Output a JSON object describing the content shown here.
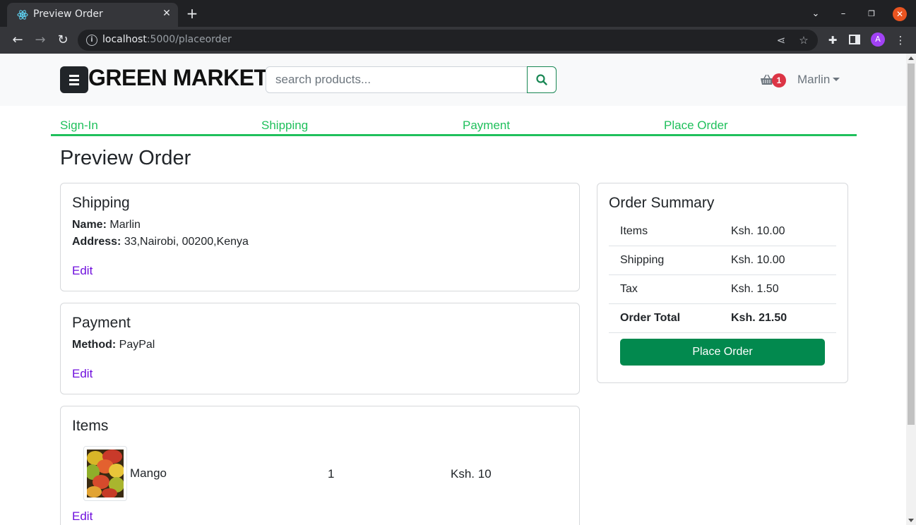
{
  "browser": {
    "tab_title": "Preview Order",
    "url_host": "localhost",
    "url_rest": ":5000/placeorder",
    "profile_initial": "A"
  },
  "navbar": {
    "brand": "GREEN MARKET",
    "search_placeholder": "search products...",
    "cart_count": "1",
    "user_name": "Marlin"
  },
  "checkout_steps": [
    "Sign-In",
    "Shipping",
    "Payment",
    "Place Order"
  ],
  "page_title": "Preview Order",
  "shipping_card": {
    "title": "Shipping",
    "name_label": "Name:",
    "name_value": "Marlin",
    "address_label": "Address:",
    "address_value": "33,Nairobi, 00200,Kenya",
    "edit_label": "Edit"
  },
  "payment_card": {
    "title": "Payment",
    "method_label": "Method:",
    "method_value": "PayPal",
    "edit_label": "Edit"
  },
  "items_card": {
    "title": "Items",
    "items": [
      {
        "name": "Mango",
        "quantity": "1",
        "price": "Ksh. 10"
      }
    ],
    "edit_label": "Edit"
  },
  "order_summary": {
    "title": "Order Summary",
    "rows": [
      {
        "label": "Items",
        "value": "Ksh. 10.00"
      },
      {
        "label": "Shipping",
        "value": "Ksh. 10.00"
      },
      {
        "label": "Tax",
        "value": "Ksh. 1.50"
      },
      {
        "label": "Order Total",
        "value": "Ksh. 21.50"
      }
    ],
    "button_label": "Place Order"
  },
  "colors": {
    "accent_green": "#20c05c",
    "button_green": "#02894e",
    "link_purple": "#6f0fdd",
    "badge_red": "#dc3545"
  }
}
